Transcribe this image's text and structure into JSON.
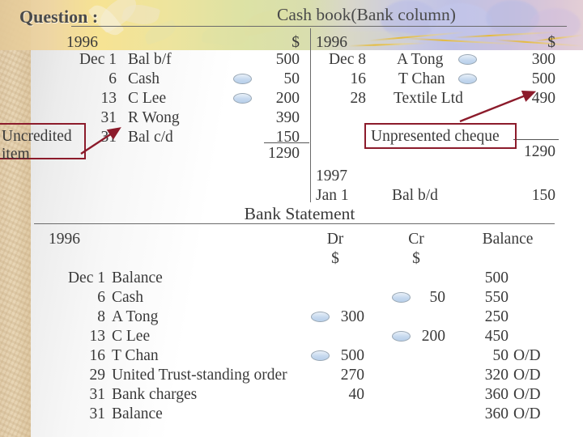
{
  "slide": {
    "question_label": "Question :",
    "cashbook_title": "Cash book(Bank column)",
    "bank_statement_title": "Bank Statement"
  },
  "colors": {
    "annotation_border": "#8c1b2b",
    "arrow": "#8c1b2b",
    "text": "#3a3a3a",
    "rule": "#6b6b6b",
    "marker_fill": "#c6d9ef",
    "marker_border": "#9aa8b5"
  },
  "cashbook": {
    "debit": {
      "year": "1996",
      "currency": "$",
      "rows": [
        {
          "date": "Dec 1",
          "particular": "Bal b/f",
          "amount": "500",
          "marked": false
        },
        {
          "date": "6",
          "particular": "Cash",
          "amount": "50",
          "marked": true
        },
        {
          "date": "13",
          "particular": "C Lee",
          "amount": "200",
          "marked": true
        },
        {
          "date": "31",
          "particular": "R Wong",
          "amount": "390",
          "marked": false
        },
        {
          "date": "31",
          "particular": "Bal c/d",
          "amount": "150",
          "marked": false
        }
      ],
      "total": "1290",
      "opening_year": "",
      "opening_date": "",
      "opening_particular": "",
      "opening_amount": ""
    },
    "credit": {
      "year": "1996",
      "currency": "$",
      "rows": [
        {
          "date": "Dec 8",
          "particular": "A Tong",
          "amount": "300",
          "marked": true
        },
        {
          "date": "16",
          "particular": "T Chan",
          "amount": "500",
          "marked": true
        },
        {
          "date": "28",
          "particular": "Textile Ltd",
          "amount": "490",
          "marked": false
        }
      ],
      "total": "1290",
      "opening_year": "1997",
      "opening_date": "Jan 1",
      "opening_particular": "Bal b/d",
      "opening_amount": "150"
    }
  },
  "annotations": [
    {
      "name": "uncredited-item",
      "text_line1": "Uncredited",
      "text_line2": "item"
    },
    {
      "name": "unpresented-cheque",
      "text_line1": "Unpresented cheque",
      "text_line2": ""
    }
  ],
  "bank_statement": {
    "year": "1996",
    "columns": [
      "Dr",
      "Cr",
      "Balance"
    ],
    "currency_dr": "$",
    "currency_cr": "$",
    "rows": [
      {
        "date": "Dec  1",
        "particular": "Balance",
        "dr": "",
        "dr_marked": false,
        "cr": "",
        "cr_marked": false,
        "balance": "500",
        "od": ""
      },
      {
        "date": "6",
        "particular": "Cash",
        "dr": "",
        "dr_marked": false,
        "cr": "50",
        "cr_marked": true,
        "balance": "550",
        "od": ""
      },
      {
        "date": "8",
        "particular": "A Tong",
        "dr": "300",
        "dr_marked": true,
        "cr": "",
        "cr_marked": false,
        "balance": "250",
        "od": ""
      },
      {
        "date": "13",
        "particular": "C Lee",
        "dr": "",
        "dr_marked": false,
        "cr": "200",
        "cr_marked": true,
        "balance": "450",
        "od": ""
      },
      {
        "date": "16",
        "particular": "T Chan",
        "dr": "500",
        "dr_marked": true,
        "cr": "",
        "cr_marked": false,
        "balance": "50",
        "od": "O/D"
      },
      {
        "date": "29",
        "particular": "United Trust-standing order",
        "dr": "270",
        "dr_marked": false,
        "cr": "",
        "cr_marked": false,
        "balance": "320",
        "od": "O/D"
      },
      {
        "date": "31",
        "particular": "Bank charges",
        "dr": "40",
        "dr_marked": false,
        "cr": "",
        "cr_marked": false,
        "balance": "360",
        "od": "O/D"
      },
      {
        "date": "31",
        "particular": "Balance",
        "dr": "",
        "dr_marked": false,
        "cr": "",
        "cr_marked": false,
        "balance": "360",
        "od": "O/D"
      }
    ]
  }
}
